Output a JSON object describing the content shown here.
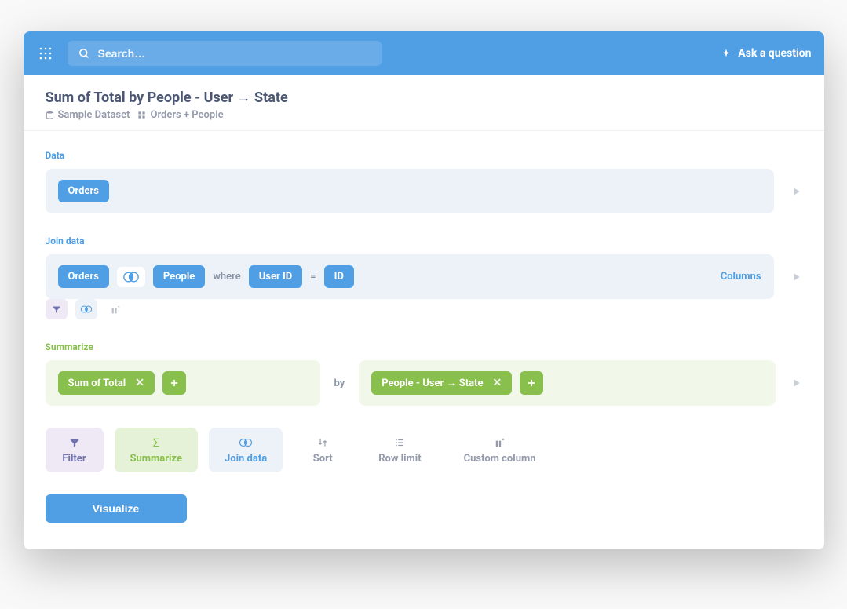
{
  "header": {
    "search_placeholder": "Search…",
    "ask_question": "Ask a question"
  },
  "page": {
    "title": "Sum of Total by People - User → State",
    "breadcrumb_db": "Sample Dataset",
    "breadcrumb_table": "Orders + People"
  },
  "sections": {
    "data_label": "Data",
    "data_chip": "Orders",
    "join_label": "Join data",
    "join": {
      "left_table": "Orders",
      "right_table": "People",
      "where": "where",
      "left_col": "User ID",
      "eq": "=",
      "right_col": "ID",
      "columns_link": "Columns"
    },
    "summarize_label": "Summarize",
    "summarize": {
      "metric": "Sum of Total",
      "by": "by",
      "dimension": "People - User → State"
    }
  },
  "actions": {
    "filter": "Filter",
    "summarize": "Summarize",
    "join_data": "Join data",
    "sort": "Sort",
    "row_limit": "Row limit",
    "custom_column": "Custom column"
  },
  "visualize": "Visualize"
}
